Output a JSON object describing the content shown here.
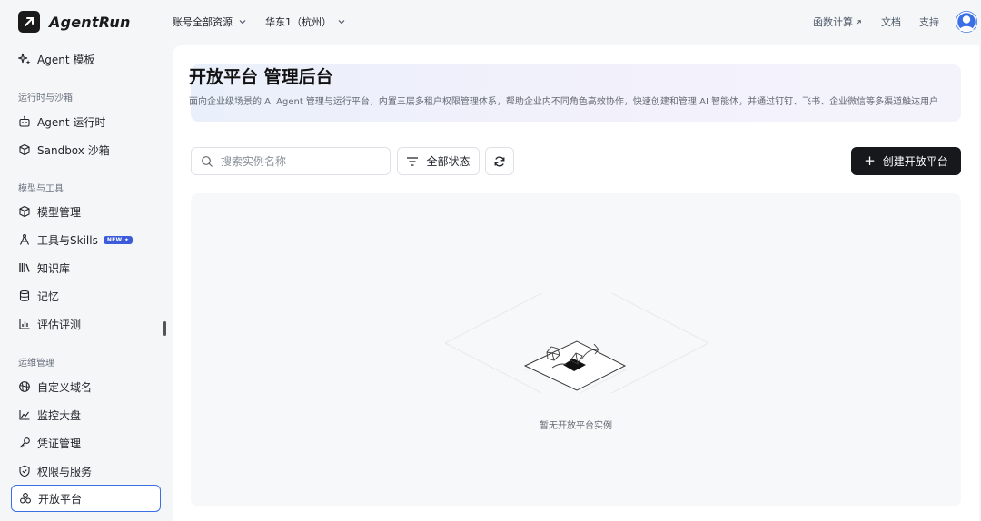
{
  "app": {
    "name": "AgentRun"
  },
  "header": {
    "account_selector": "账号全部资源",
    "region_selector": "华东1（杭州）",
    "links": {
      "function_compute": "函数计算",
      "docs": "文档",
      "support": "支持"
    }
  },
  "sidebar": {
    "top_item": "Agent 模板",
    "groups": {
      "runtime": "运行时与沙箱",
      "models": "模型与工具",
      "ops": "运维管理"
    },
    "items": {
      "agent_runtime": "Agent 运行时",
      "sandbox": "Sandbox 沙箱",
      "model_mgmt": "模型管理",
      "tools_skills": "工具与Skills",
      "new_badge": "NEW",
      "knowledge": "知识库",
      "memory": "记忆",
      "evaluation": "评估评测",
      "custom_domain": "自定义域名",
      "monitor": "监控大盘",
      "credentials": "凭证管理",
      "permissions": "权限与服务",
      "open_platform": "开放平台"
    },
    "active": "open_platform"
  },
  "main": {
    "title": "开放平台 管理后台",
    "description": "面向企业级场景的 AI Agent 管理与运行平台，内置三层多租户权限管理体系，帮助企业内不同角色高效协作，快速创建和管理 AI 智能体，并通过钉钉、飞书、企业微信等多渠道触达用户",
    "search": {
      "placeholder": "搜索实例名称",
      "value": ""
    },
    "filter_label": "全部状态",
    "create_label": "创建开放平台",
    "empty_text": "暂无开放平台实例"
  },
  "colors": {
    "accent": "#3b6fe6",
    "primary_button": "#16181c",
    "badge": "#3b5bdb"
  }
}
